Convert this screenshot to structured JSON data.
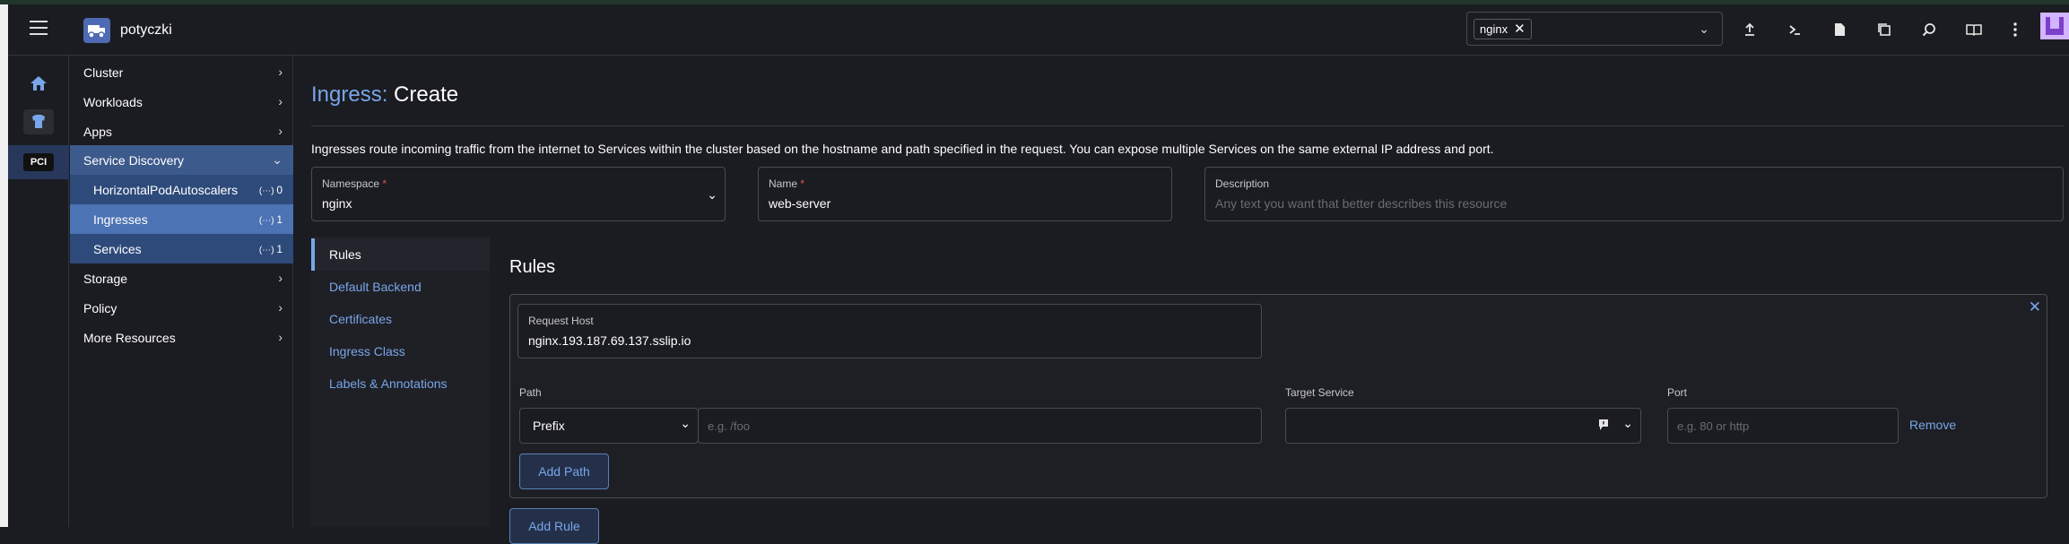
{
  "header": {
    "cluster_name": "potyczki",
    "namespace_chip": "nginx",
    "icons": [
      "upload-icon",
      "terminal-icon",
      "file-icon",
      "copy-config-icon",
      "search-icon",
      "book-icon",
      "kebab-menu-icon"
    ]
  },
  "rail": {
    "pci_label": "PCI"
  },
  "nav": {
    "cluster": "Cluster",
    "workloads": "Workloads",
    "apps": "Apps",
    "service_discovery": "Service Discovery",
    "hpa": "HorizontalPodAutoscalers",
    "hpa_count": "0",
    "ingresses": "Ingresses",
    "ingresses_count": "1",
    "services": "Services",
    "services_count": "1",
    "storage": "Storage",
    "policy": "Policy",
    "more_resources": "More Resources"
  },
  "page": {
    "title_link": "Ingress:",
    "title_action": "Create",
    "description": "Ingresses route incoming traffic from the internet to Services within the cluster based on the hostname and path specified in the request. You can expose multiple Services on the same external IP address and port."
  },
  "form": {
    "namespace_label": "Namespace",
    "namespace_value": "nginx",
    "name_label": "Name",
    "name_value": "web-server",
    "description_label": "Description",
    "description_placeholder": "Any text you want that better describes this resource"
  },
  "tabs": [
    "Rules",
    "Default Backend",
    "Certificates",
    "Ingress Class",
    "Labels & Annotations"
  ],
  "rules": {
    "heading": "Rules",
    "request_host_label": "Request Host",
    "request_host_value": "nginx.193.187.69.137.sslip.io",
    "path_label": "Path",
    "path_type": "Prefix",
    "path_placeholder": "e.g. /foo",
    "target_service_label": "Target Service",
    "port_label": "Port",
    "port_placeholder": "e.g. 80 or http",
    "remove_label": "Remove",
    "add_path_label": "Add Path",
    "add_rule_label": "Add Rule"
  }
}
